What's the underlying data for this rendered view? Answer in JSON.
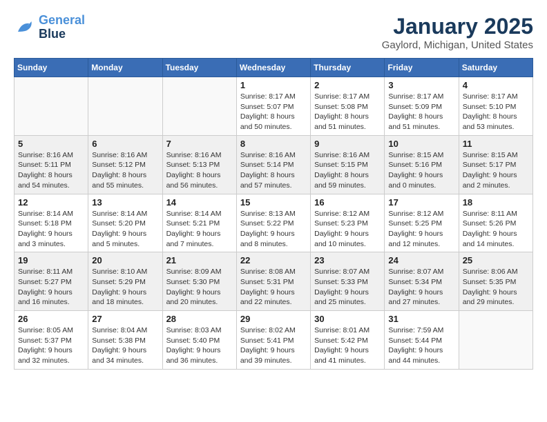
{
  "header": {
    "logo_line1": "General",
    "logo_line2": "Blue",
    "month": "January 2025",
    "location": "Gaylord, Michigan, United States"
  },
  "weekdays": [
    "Sunday",
    "Monday",
    "Tuesday",
    "Wednesday",
    "Thursday",
    "Friday",
    "Saturday"
  ],
  "weeks": [
    [
      {
        "day": "",
        "info": ""
      },
      {
        "day": "",
        "info": ""
      },
      {
        "day": "",
        "info": ""
      },
      {
        "day": "1",
        "info": "Sunrise: 8:17 AM\nSunset: 5:07 PM\nDaylight: 8 hours\nand 50 minutes."
      },
      {
        "day": "2",
        "info": "Sunrise: 8:17 AM\nSunset: 5:08 PM\nDaylight: 8 hours\nand 51 minutes."
      },
      {
        "day": "3",
        "info": "Sunrise: 8:17 AM\nSunset: 5:09 PM\nDaylight: 8 hours\nand 51 minutes."
      },
      {
        "day": "4",
        "info": "Sunrise: 8:17 AM\nSunset: 5:10 PM\nDaylight: 8 hours\nand 53 minutes."
      }
    ],
    [
      {
        "day": "5",
        "info": "Sunrise: 8:16 AM\nSunset: 5:11 PM\nDaylight: 8 hours\nand 54 minutes."
      },
      {
        "day": "6",
        "info": "Sunrise: 8:16 AM\nSunset: 5:12 PM\nDaylight: 8 hours\nand 55 minutes."
      },
      {
        "day": "7",
        "info": "Sunrise: 8:16 AM\nSunset: 5:13 PM\nDaylight: 8 hours\nand 56 minutes."
      },
      {
        "day": "8",
        "info": "Sunrise: 8:16 AM\nSunset: 5:14 PM\nDaylight: 8 hours\nand 57 minutes."
      },
      {
        "day": "9",
        "info": "Sunrise: 8:16 AM\nSunset: 5:15 PM\nDaylight: 8 hours\nand 59 minutes."
      },
      {
        "day": "10",
        "info": "Sunrise: 8:15 AM\nSunset: 5:16 PM\nDaylight: 9 hours\nand 0 minutes."
      },
      {
        "day": "11",
        "info": "Sunrise: 8:15 AM\nSunset: 5:17 PM\nDaylight: 9 hours\nand 2 minutes."
      }
    ],
    [
      {
        "day": "12",
        "info": "Sunrise: 8:14 AM\nSunset: 5:18 PM\nDaylight: 9 hours\nand 3 minutes."
      },
      {
        "day": "13",
        "info": "Sunrise: 8:14 AM\nSunset: 5:20 PM\nDaylight: 9 hours\nand 5 minutes."
      },
      {
        "day": "14",
        "info": "Sunrise: 8:14 AM\nSunset: 5:21 PM\nDaylight: 9 hours\nand 7 minutes."
      },
      {
        "day": "15",
        "info": "Sunrise: 8:13 AM\nSunset: 5:22 PM\nDaylight: 9 hours\nand 8 minutes."
      },
      {
        "day": "16",
        "info": "Sunrise: 8:12 AM\nSunset: 5:23 PM\nDaylight: 9 hours\nand 10 minutes."
      },
      {
        "day": "17",
        "info": "Sunrise: 8:12 AM\nSunset: 5:25 PM\nDaylight: 9 hours\nand 12 minutes."
      },
      {
        "day": "18",
        "info": "Sunrise: 8:11 AM\nSunset: 5:26 PM\nDaylight: 9 hours\nand 14 minutes."
      }
    ],
    [
      {
        "day": "19",
        "info": "Sunrise: 8:11 AM\nSunset: 5:27 PM\nDaylight: 9 hours\nand 16 minutes."
      },
      {
        "day": "20",
        "info": "Sunrise: 8:10 AM\nSunset: 5:29 PM\nDaylight: 9 hours\nand 18 minutes."
      },
      {
        "day": "21",
        "info": "Sunrise: 8:09 AM\nSunset: 5:30 PM\nDaylight: 9 hours\nand 20 minutes."
      },
      {
        "day": "22",
        "info": "Sunrise: 8:08 AM\nSunset: 5:31 PM\nDaylight: 9 hours\nand 22 minutes."
      },
      {
        "day": "23",
        "info": "Sunrise: 8:07 AM\nSunset: 5:33 PM\nDaylight: 9 hours\nand 25 minutes."
      },
      {
        "day": "24",
        "info": "Sunrise: 8:07 AM\nSunset: 5:34 PM\nDaylight: 9 hours\nand 27 minutes."
      },
      {
        "day": "25",
        "info": "Sunrise: 8:06 AM\nSunset: 5:35 PM\nDaylight: 9 hours\nand 29 minutes."
      }
    ],
    [
      {
        "day": "26",
        "info": "Sunrise: 8:05 AM\nSunset: 5:37 PM\nDaylight: 9 hours\nand 32 minutes."
      },
      {
        "day": "27",
        "info": "Sunrise: 8:04 AM\nSunset: 5:38 PM\nDaylight: 9 hours\nand 34 minutes."
      },
      {
        "day": "28",
        "info": "Sunrise: 8:03 AM\nSunset: 5:40 PM\nDaylight: 9 hours\nand 36 minutes."
      },
      {
        "day": "29",
        "info": "Sunrise: 8:02 AM\nSunset: 5:41 PM\nDaylight: 9 hours\nand 39 minutes."
      },
      {
        "day": "30",
        "info": "Sunrise: 8:01 AM\nSunset: 5:42 PM\nDaylight: 9 hours\nand 41 minutes."
      },
      {
        "day": "31",
        "info": "Sunrise: 7:59 AM\nSunset: 5:44 PM\nDaylight: 9 hours\nand 44 minutes."
      },
      {
        "day": "",
        "info": ""
      }
    ]
  ]
}
